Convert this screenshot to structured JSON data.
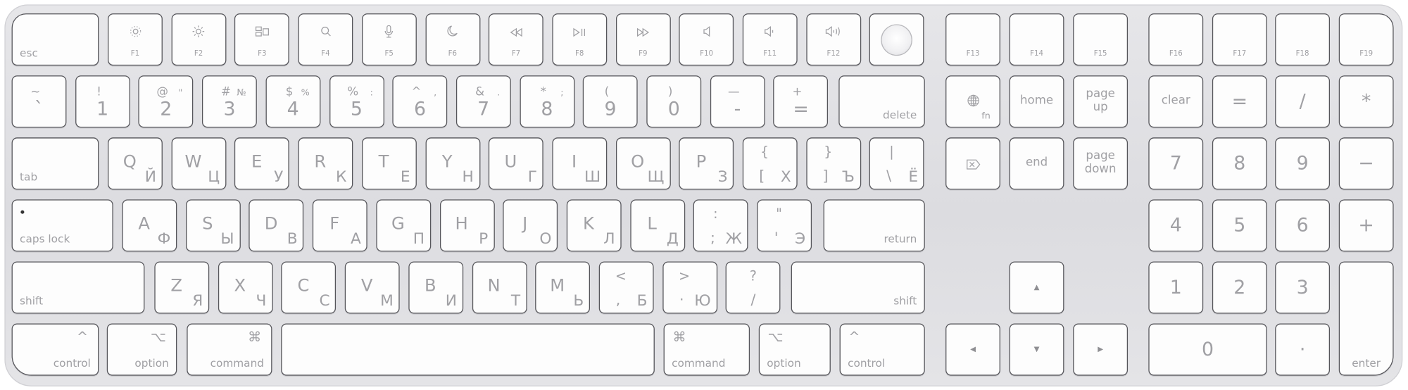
{
  "colors": {
    "key_face": "#fdfdfd",
    "key_outline": "#55555a",
    "legend": "#a0a0a4",
    "chassis": "#e0e0e4"
  },
  "main": {
    "rows": [
      [
        {
          "t": "mod",
          "label": "esc",
          "align": "left"
        },
        {
          "t": "fn",
          "f": "F1",
          "icon": "brightness-down"
        },
        {
          "t": "fn",
          "f": "F2",
          "icon": "brightness-up"
        },
        {
          "t": "fn",
          "f": "F3",
          "icon": "mission-control"
        },
        {
          "t": "fn",
          "f": "F4",
          "icon": "search"
        },
        {
          "t": "fn",
          "f": "F5",
          "icon": "microphone"
        },
        {
          "t": "fn",
          "f": "F6",
          "icon": "moon"
        },
        {
          "t": "fn",
          "f": "F7",
          "icon": "rewind"
        },
        {
          "t": "fn",
          "f": "F8",
          "icon": "play-pause"
        },
        {
          "t": "fn",
          "f": "F9",
          "icon": "fast-forward"
        },
        {
          "t": "fn",
          "f": "F10",
          "icon": "mute"
        },
        {
          "t": "fn",
          "f": "F11",
          "icon": "volume-down"
        },
        {
          "t": "fn",
          "f": "F12",
          "icon": "volume-up"
        },
        {
          "t": "touchid",
          "icon": "touch-id"
        }
      ],
      [
        {
          "t": "digit",
          "shift": "~",
          "base": "`"
        },
        {
          "t": "digit",
          "shift": "!",
          "base": "1"
        },
        {
          "t": "digit",
          "shift": "@",
          "ru": "\"",
          "base": "2"
        },
        {
          "t": "digit",
          "shift": "#",
          "ru": "№",
          "base": "3"
        },
        {
          "t": "digit",
          "shift": "$",
          "ru": "%",
          "base": "4"
        },
        {
          "t": "digit",
          "shift": "%",
          "ru": ":",
          "base": "5"
        },
        {
          "t": "digit",
          "shift": "^",
          "ru": ",",
          "base": "6"
        },
        {
          "t": "digit",
          "shift": "&",
          "ru": ".",
          "base": "7"
        },
        {
          "t": "digit",
          "shift": "*",
          "ru": ";",
          "base": "8"
        },
        {
          "t": "digit",
          "shift": "(",
          "base": "9"
        },
        {
          "t": "digit",
          "shift": ")",
          "base": "0"
        },
        {
          "t": "digit",
          "shift": "—",
          "base": "-"
        },
        {
          "t": "digit",
          "shift": "+",
          "base": "="
        },
        {
          "t": "mod",
          "label": "delete",
          "align": "right"
        }
      ],
      [
        {
          "t": "mod",
          "label": "tab",
          "align": "left"
        },
        {
          "t": "letter",
          "latin": "Q",
          "cyr": "Й"
        },
        {
          "t": "letter",
          "latin": "W",
          "cyr": "Ц"
        },
        {
          "t": "letter",
          "latin": "E",
          "cyr": "У"
        },
        {
          "t": "letter",
          "latin": "R",
          "cyr": "К"
        },
        {
          "t": "letter",
          "latin": "T",
          "cyr": "Е"
        },
        {
          "t": "letter",
          "latin": "Y",
          "cyr": "Н"
        },
        {
          "t": "letter",
          "latin": "U",
          "cyr": "Г"
        },
        {
          "t": "letter",
          "latin": "I",
          "cyr": "Ш"
        },
        {
          "t": "letter",
          "latin": "O",
          "cyr": "Щ"
        },
        {
          "t": "letter",
          "latin": "P",
          "cyr": "З"
        },
        {
          "t": "punct",
          "shift": "{",
          "base": "[",
          "cyr": "Х"
        },
        {
          "t": "punct",
          "shift": "}",
          "base": "]",
          "cyr": "Ъ"
        },
        {
          "t": "punct",
          "shift": "|",
          "base": "\\",
          "cyr": "Ё"
        }
      ],
      [
        {
          "t": "mod",
          "label": "caps lock",
          "align": "left",
          "led": true
        },
        {
          "t": "letter",
          "latin": "A",
          "cyr": "Ф"
        },
        {
          "t": "letter",
          "latin": "S",
          "cyr": "Ы"
        },
        {
          "t": "letter",
          "latin": "D",
          "cyr": "В"
        },
        {
          "t": "letter",
          "latin": "F",
          "cyr": "А"
        },
        {
          "t": "letter",
          "latin": "G",
          "cyr": "П"
        },
        {
          "t": "letter",
          "latin": "H",
          "cyr": "Р"
        },
        {
          "t": "letter",
          "latin": "J",
          "cyr": "О"
        },
        {
          "t": "letter",
          "latin": "K",
          "cyr": "Л"
        },
        {
          "t": "letter",
          "latin": "L",
          "cyr": "Д"
        },
        {
          "t": "punct",
          "shift": ":",
          "base": ";",
          "cyr": "Ж"
        },
        {
          "t": "punct",
          "shift": "\"",
          "base": "'",
          "cyr": "Э"
        },
        {
          "t": "mod",
          "label": "return",
          "align": "right"
        }
      ],
      [
        {
          "t": "mod",
          "label": "shift",
          "align": "left"
        },
        {
          "t": "letter",
          "latin": "Z",
          "cyr": "Я"
        },
        {
          "t": "letter",
          "latin": "X",
          "cyr": "Ч"
        },
        {
          "t": "letter",
          "latin": "C",
          "cyr": "С"
        },
        {
          "t": "letter",
          "latin": "V",
          "cyr": "М"
        },
        {
          "t": "letter",
          "latin": "B",
          "cyr": "И"
        },
        {
          "t": "letter",
          "latin": "N",
          "cyr": "Т"
        },
        {
          "t": "letter",
          "latin": "M",
          "cyr": "Ь"
        },
        {
          "t": "punct",
          "shift": "<",
          "base": ",",
          "cyr": "Б"
        },
        {
          "t": "punct",
          "shift": ">",
          "base": "·",
          "cyr": "Ю"
        },
        {
          "t": "punct",
          "shift": "?",
          "base": "/"
        },
        {
          "t": "mod",
          "label": "shift",
          "align": "right"
        }
      ],
      [
        {
          "t": "mod",
          "label": "control",
          "glyph": "^",
          "align": "right"
        },
        {
          "t": "mod",
          "label": "option",
          "glyph": "⌥",
          "align": "right"
        },
        {
          "t": "mod",
          "label": "command",
          "glyph": "⌘",
          "align": "right"
        },
        {
          "t": "space"
        },
        {
          "t": "mod",
          "label": "command",
          "glyph": "⌘",
          "align": "left"
        },
        {
          "t": "mod",
          "label": "option",
          "glyph": "⌥",
          "align": "left"
        },
        {
          "t": "mod",
          "label": "control",
          "glyph": "^",
          "align": "left"
        }
      ]
    ]
  },
  "nav": [
    {
      "t": "fn",
      "f": "F13"
    },
    {
      "t": "fn",
      "f": "F14"
    },
    {
      "t": "fn",
      "f": "F15"
    },
    {
      "t": "globe",
      "icon": "globe",
      "label": "fn"
    },
    {
      "t": "center",
      "center": "home"
    },
    {
      "t": "center",
      "center": "page\nup"
    },
    {
      "t": "fwd",
      "icon": "forward-delete"
    },
    {
      "t": "center",
      "center": "end"
    },
    {
      "t": "center",
      "center": "page\ndown"
    },
    {
      "t": "arrow",
      "arrow": "▲",
      "icon": "arrow-up"
    },
    {
      "t": "arrow",
      "arrow": "◀",
      "icon": "arrow-left"
    },
    {
      "t": "arrow",
      "arrow": "▼",
      "icon": "arrow-down"
    },
    {
      "t": "arrow",
      "arrow": "▶",
      "icon": "arrow-right"
    }
  ],
  "numpad": [
    {
      "t": "fn",
      "f": "F16"
    },
    {
      "t": "fn",
      "f": "F17"
    },
    {
      "t": "fn",
      "f": "F18"
    },
    {
      "t": "fn",
      "f": "F19"
    },
    {
      "t": "center",
      "center": "clear"
    },
    {
      "t": "num",
      "big": "="
    },
    {
      "t": "num",
      "big": "/"
    },
    {
      "t": "num",
      "big": "*"
    },
    {
      "t": "num",
      "big": "7"
    },
    {
      "t": "num",
      "big": "8"
    },
    {
      "t": "num",
      "big": "9"
    },
    {
      "t": "num",
      "big": "−"
    },
    {
      "t": "num",
      "big": "4"
    },
    {
      "t": "num",
      "big": "5"
    },
    {
      "t": "num",
      "big": "6"
    },
    {
      "t": "num",
      "big": "+"
    },
    {
      "t": "num",
      "big": "1"
    },
    {
      "t": "num",
      "big": "2"
    },
    {
      "t": "num",
      "big": "3"
    },
    {
      "t": "mod",
      "label": "enter",
      "align": "center"
    },
    {
      "t": "num",
      "big": "0"
    },
    {
      "t": "num",
      "big": "·"
    }
  ]
}
